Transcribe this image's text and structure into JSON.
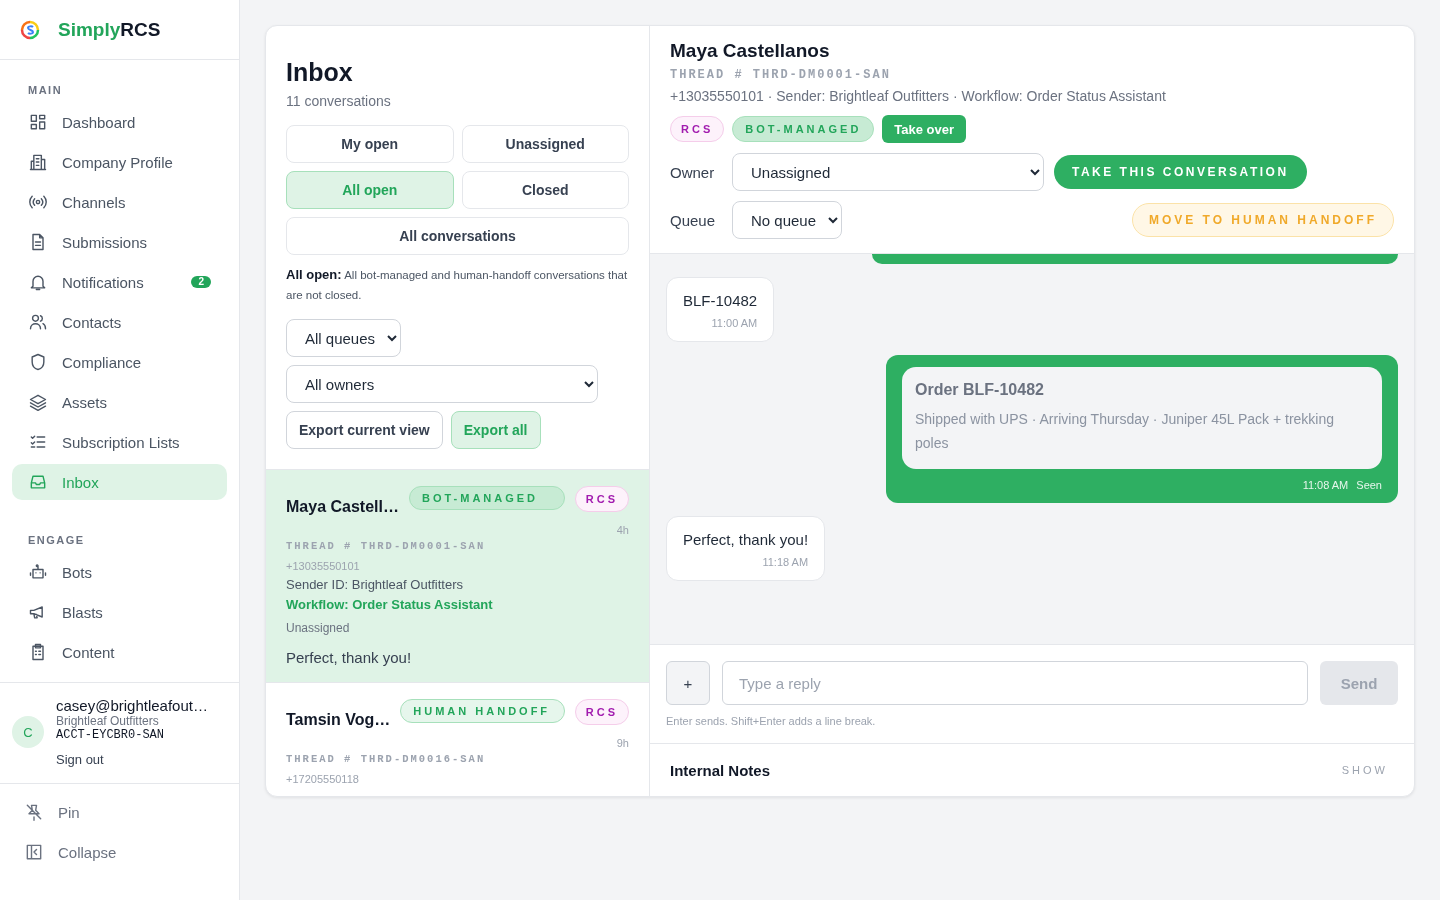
{
  "brand": {
    "accent": "Simply",
    "rest": "RCS"
  },
  "sidebar": {
    "sections": [
      {
        "title": "MAIN",
        "items": [
          {
            "label": "Dashboard",
            "selected": false
          },
          {
            "label": "Company Profile",
            "selected": false
          },
          {
            "label": "Channels",
            "selected": false
          },
          {
            "label": "Submissions",
            "selected": false
          },
          {
            "label": "Notifications",
            "selected": false,
            "badge": "2"
          },
          {
            "label": "Contacts",
            "selected": false
          },
          {
            "label": "Compliance",
            "selected": false
          },
          {
            "label": "Assets",
            "selected": false
          },
          {
            "label": "Subscription Lists",
            "selected": false
          },
          {
            "label": "Inbox",
            "selected": true
          }
        ]
      },
      {
        "title": "ENGAGE",
        "items": [
          {
            "label": "Bots",
            "selected": false
          },
          {
            "label": "Blasts",
            "selected": false
          },
          {
            "label": "Content",
            "selected": false
          }
        ]
      }
    ],
    "user": {
      "avatar": "C",
      "email": "casey@brightleafout…",
      "org": "Brightleaf Outfitters",
      "account": "ACCT-EYCBR0-SAN",
      "sign_out": "Sign out"
    },
    "footer": [
      "Pin",
      "Collapse"
    ]
  },
  "inbox": {
    "title": "Inbox",
    "count": "11 conversations",
    "filters": [
      {
        "label": "My open",
        "selected": false
      },
      {
        "label": "Unassigned",
        "selected": false
      },
      {
        "label": "All open",
        "selected": true
      },
      {
        "label": "Closed",
        "selected": false
      },
      {
        "label": "All conversations",
        "selected": false
      }
    ],
    "description": "**All open:** All bot-managed and human-handoff conversations that are not closed.",
    "queue_filter": "All queues",
    "owner_filter": "All owners",
    "export_buttons": [
      {
        "label": "Export current view",
        "kind": "plain"
      },
      {
        "label": "Export all",
        "kind": "accent"
      }
    ],
    "conversations": [
      {
        "name": "Maya Castell…",
        "status": {
          "kind": "bot",
          "label": "BOT-MANAGED"
        },
        "channel": "RCS",
        "time": "4h",
        "thread": "THREAD # THRD-DM0001-SAN",
        "phone": "+13035550101",
        "sender": "Sender ID: Brightleaf Outfitters",
        "workflow": "Workflow: Order Status Assistant",
        "owner": "Unassigned",
        "preview": "Perfect, thank you!",
        "selected": true
      },
      {
        "name": "Tamsin Vog…",
        "status": {
          "kind": "human",
          "label": "HUMAN HANDOFF"
        },
        "channel": "RCS",
        "time": "9h",
        "thread": "THREAD # THRD-DM0016-SAN",
        "phone": "+17205550118",
        "selected": false
      }
    ]
  },
  "conversation": {
    "name": "Maya Castellanos",
    "thread": "THREAD # THRD-DM0001-SAN",
    "meta": "+13035550101 · Sender: Brightleaf Outfitters · Workflow: Order Status Assistant",
    "channel": "RCS",
    "status": {
      "kind": "bot",
      "label": "BOT-MANAGED"
    },
    "take_over": "Take over",
    "owner_label": "Owner",
    "owner": "Unassigned",
    "take_button": "TAKE THIS CONVERSATION",
    "queue_label": "Queue",
    "queue": "No queue",
    "handoff_button": "MOVE TO HUMAN HANDOFF",
    "messages": [
      {
        "kind": "clipped"
      },
      {
        "kind": "incoming",
        "text": "BLF-10482",
        "time": "11:00 AM"
      },
      {
        "kind": "card",
        "title": "Order BLF-10482",
        "text": "Shipped with UPS · Arriving Thursday · Juniper 45L Pack + trekking poles",
        "time": "11:08 AM",
        "receipt": "Seen"
      },
      {
        "kind": "incoming",
        "text": "Perfect, thank you!",
        "time": "11:18 AM"
      }
    ],
    "composer": {
      "attach": "+",
      "placeholder": "Type a reply",
      "send": "Send",
      "send_disabled": true,
      "hint": "Enter sends. Shift+Enter adds a line break."
    },
    "notes": {
      "title": "Internal Notes",
      "toggle": "SHOW"
    }
  }
}
